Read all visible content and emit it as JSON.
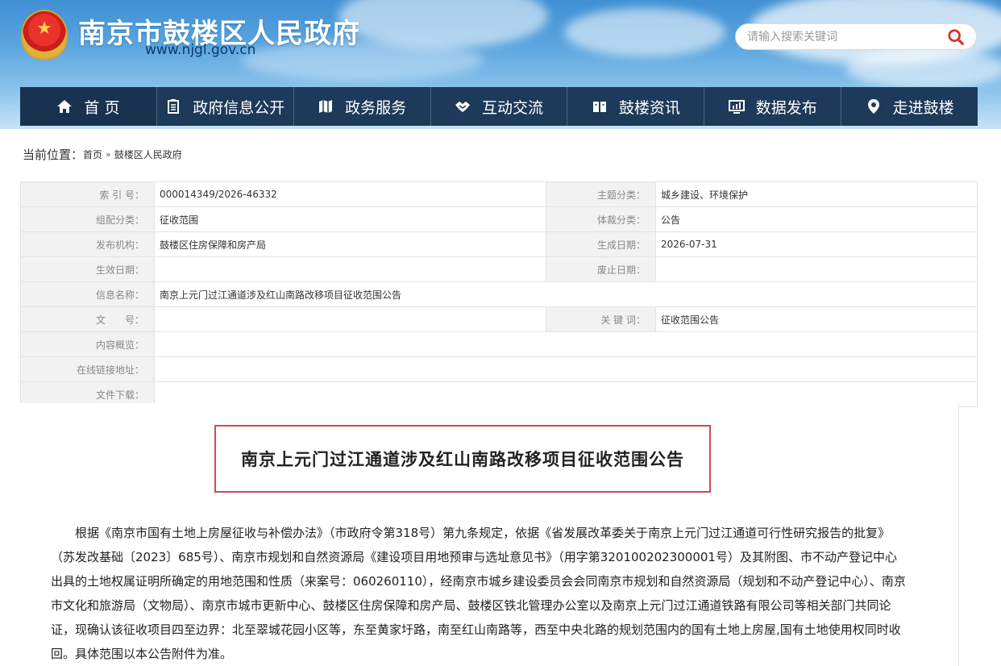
{
  "header": {
    "site_title": "南京市鼓楼区人民政府",
    "site_url": "www.njgl.gov.cn",
    "search_placeholder": "请输入搜索关键词"
  },
  "nav": {
    "items": [
      {
        "label": "首 页",
        "icon": "home-icon"
      },
      {
        "label": "政府信息公开",
        "icon": "document-icon"
      },
      {
        "label": "政务服务",
        "icon": "map-icon"
      },
      {
        "label": "互动交流",
        "icon": "handshake-icon"
      },
      {
        "label": "鼓楼资讯",
        "icon": "book-icon"
      },
      {
        "label": "数据发布",
        "icon": "monitor-icon"
      },
      {
        "label": "走进鼓楼",
        "icon": "location-icon"
      }
    ]
  },
  "breadcrumb": {
    "label": "当前位置：",
    "items": [
      "首页",
      "鼓楼区人民政府"
    ],
    "separator": "»"
  },
  "meta": {
    "index_no_label": "索 引 号：",
    "index_no": "000014349/2026-46332",
    "topic_label": "主题分类：",
    "topic": "城乡建设、环境保护",
    "org_category_label": "组配分类：",
    "org_category": "征收范围",
    "genre_label": "体裁分类：",
    "genre": "公告",
    "publisher_label": "发布机构：",
    "publisher": "鼓楼区住房保障和房产局",
    "created_label": "生成日期：",
    "created": "2026-07-31",
    "effective_label": "生效日期：",
    "effective": "",
    "expired_label": "废止日期：",
    "expired": "",
    "info_name_label": "信息名称：",
    "info_name": "南京上元门过江通道涉及红山南路改移项目征收范围公告",
    "doc_no_label": "文　　号：",
    "doc_no": "",
    "keywords_label": "关 键 词：",
    "keywords": "征收范围公告",
    "summary_label": "内容概览：",
    "summary": "",
    "link_label": "在线链接地址：",
    "link": "",
    "download_label": "文件下载：",
    "download": ""
  },
  "article": {
    "title": "南京上元门过江通道涉及红山南路改移项目征收范围公告",
    "body": "根据《南京市国有土地上房屋征收与补偿办法》（市政府令第318号）第九条规定，依据《省发展改革委关于南京上元门过江通道可行性研究报告的批复》（苏发改基础〔2023〕685号）、南京市规划和自然资源局《建设项目用地预审与选址意见书》（用字第320100202300001号）及其附图、市不动产登记中心出具的土地权属证明所确定的用地范围和性质（来案号：060260110），经南京市城乡建设委员会会同南京市规划和自然资源局（规划和不动产登记中心）、南京市文化和旅游局（文物局）、南京市城市更新中心、鼓楼区住房保障和房产局、鼓楼区铁北管理办公室以及南京上元门过江通道铁路有限公司等相关部门共同论证，现确认该征收项目四至边界：北至翠城花园小区等，东至黄家圩路，南至红山南路等，西至中央北路的规划范围内的国有土地上房屋,国有土地使用权同时收回。具体范围以本公告附件为准。"
  },
  "colors": {
    "nav_bg": "#1d3a5a",
    "title_border": "#d24a4a",
    "search_icon": "#d7332b"
  }
}
